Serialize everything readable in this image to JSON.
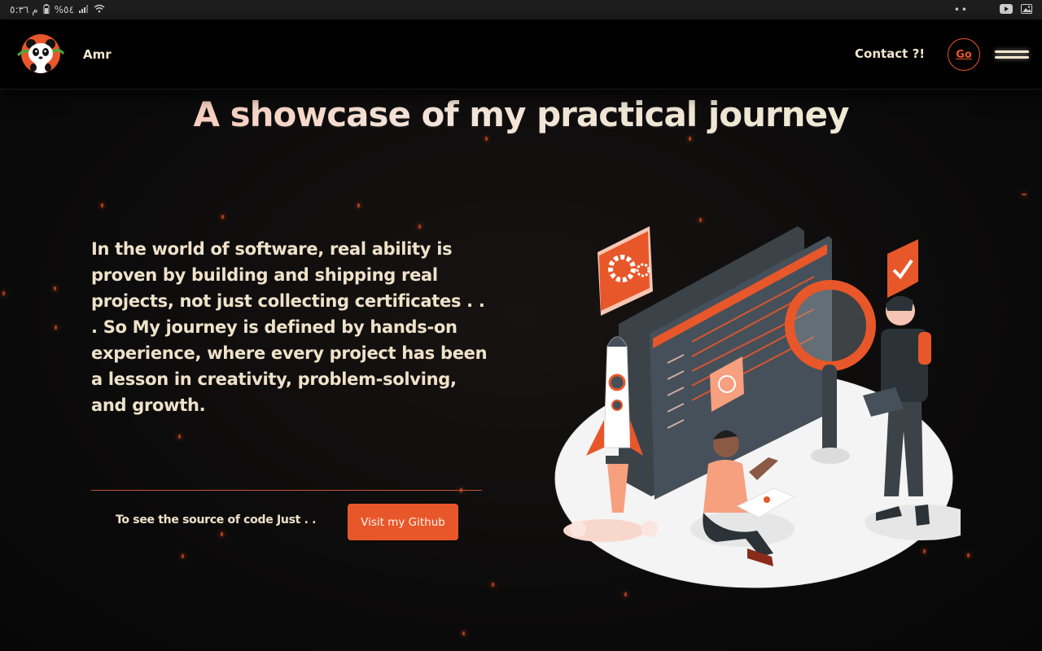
{
  "status_bar": {
    "time": "م ٥:٣٦",
    "battery": "%٥٤"
  },
  "navbar": {
    "brand_name": "Amr",
    "contact_label": "Contact ?!",
    "go_label": "Go",
    "logo_icon": "panda-logo-icon",
    "menu_icon": "hamburger-menu-icon"
  },
  "main": {
    "title": "A showcase of my practical journey",
    "intro": "In the world of software, real ability is proven by building and shipping real projects, not just collecting certificates . . . So My journey is defined by hands-on experience, where every project has been a lesson in creativity, problem-solving, and growth.",
    "github_prompt": "To see the source of code Just . .",
    "github_button_label": "Visit my Github",
    "illustration_icon": "developer-workspace-illustration"
  },
  "colors": {
    "accent": "#e8572a",
    "text": "#efe2c9",
    "background": "#0d0d0d",
    "navbar": "#000000"
  }
}
